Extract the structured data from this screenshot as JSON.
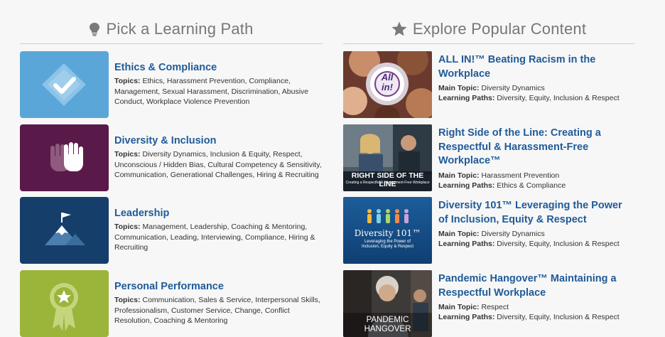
{
  "left_header": {
    "title": "Pick a Learning Path",
    "icon": "lightbulb-icon"
  },
  "right_header": {
    "title": "Explore Popular Content",
    "icon": "star-icon"
  },
  "colors": {
    "link": "#1f5b99",
    "ethics": "#5ba6d8",
    "diversity": "#5a1a49",
    "leadership": "#163e6b",
    "personal": "#9ab53a"
  },
  "learning_paths": [
    {
      "title": "Ethics & Compliance",
      "topics_label": "Topics:",
      "topics": "Ethics, Harassment Prevention, Compliance, Management, Sexual Harassment, Discrimination, Abusive Conduct, Workplace Violence Prevention",
      "icon": "checkmark-diamond-icon"
    },
    {
      "title": "Diversity & Inclusion",
      "topics_label": "Topics:",
      "topics": "Diversity Dynamics, Inclusion & Equity, Respect, Unconscious / Hidden Bias, Cultural Competency & Sensitivity, Communication, Generational Challenges, Hiring & Recruiting",
      "icon": "raised-hands-icon"
    },
    {
      "title": "Leadership",
      "topics_label": "Topics:",
      "topics": "Management, Leadership, Coaching & Mentoring, Communication, Leading, Interviewing, Compliance, Hiring & Recruiting",
      "icon": "mountain-flag-icon"
    },
    {
      "title": "Personal Performance",
      "topics_label": "Topics:",
      "topics": "Communication, Sales & Service, Interpersonal Skills, Professionalism, Customer Service, Change, Conflict Resolution, Coaching & Mentoring",
      "icon": "award-ribbon-icon"
    }
  ],
  "popular_content": [
    {
      "title": "ALL IN!™ Beating Racism in the Workplace",
      "main_topic_label": "Main Topic:",
      "main_topic": "Diversity Dynamics",
      "paths_label": "Learning Paths:",
      "paths": "Diversity, Equity, Inclusion & Respect",
      "thumb_text": [
        "All",
        "in!"
      ]
    },
    {
      "title": "Right Side of the Line: Creating a Respectful & Harassment-Free Workplace™",
      "main_topic_label": "Main Topic:",
      "main_topic": "Harassment Prevention",
      "paths_label": "Learning Paths:",
      "paths": "Ethics & Compliance",
      "thumb_text": [
        "RIGHT SIDE OF THE LINE",
        "Creating a Respectful & Harassment-Free Workplace"
      ]
    },
    {
      "title": "Diversity 101™ Leveraging the Power of Inclusion, Equity & Respect",
      "main_topic_label": "Main Topic:",
      "main_topic": "Diversity Dynamics",
      "paths_label": "Learning Paths:",
      "paths": "Diversity, Equity, Inclusion & Respect",
      "thumb_text": [
        "Diversity 101™",
        "Leveraging the Power of Inclusion, Equity & Respect"
      ]
    },
    {
      "title": "Pandemic Hangover™ Maintaining a Respectful Workplace",
      "main_topic_label": "Main Topic:",
      "main_topic": "Respect",
      "paths_label": "Learning Paths:",
      "paths": "Diversity, Equity, Inclusion & Respect",
      "thumb_text": [
        "PANDEMIC",
        "HANGOVER"
      ]
    }
  ]
}
